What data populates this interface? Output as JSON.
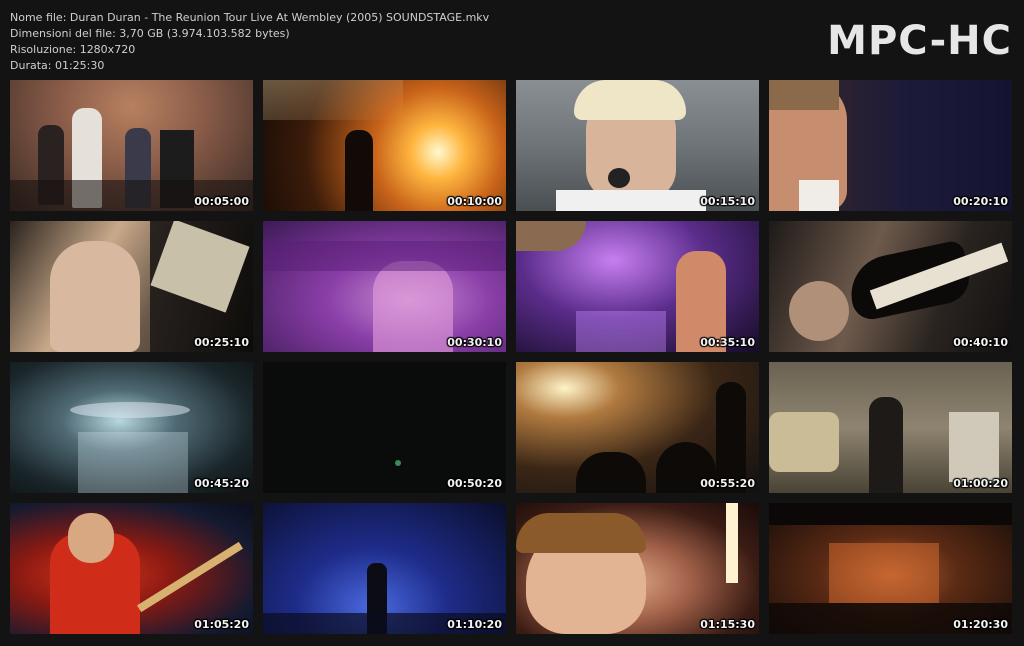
{
  "file_info": {
    "name_line": "Nome file: Duran Duran - The Reunion Tour Live At Wembley (2005) SOUNDSTAGE.mkv",
    "size_line": "Dimensioni del file: 3,70 GB (3.974.103.582 bytes)",
    "resolution_line": "Risoluzione: 1280x720",
    "duration_line": "Durata: 01:25:30"
  },
  "logo": "MPC-HC",
  "thumbnails": [
    {
      "timestamp": "00:05:00"
    },
    {
      "timestamp": "00:10:00"
    },
    {
      "timestamp": "00:15:10"
    },
    {
      "timestamp": "00:20:10"
    },
    {
      "timestamp": "00:25:10"
    },
    {
      "timestamp": "00:30:10"
    },
    {
      "timestamp": "00:35:10"
    },
    {
      "timestamp": "00:40:10"
    },
    {
      "timestamp": "00:45:20"
    },
    {
      "timestamp": "00:50:20"
    },
    {
      "timestamp": "00:55:20"
    },
    {
      "timestamp": "01:00:20"
    },
    {
      "timestamp": "01:05:20"
    },
    {
      "timestamp": "01:10:20"
    },
    {
      "timestamp": "01:15:30"
    },
    {
      "timestamp": "01:20:30"
    }
  ],
  "colors": {
    "background": "#131313",
    "info_text": "#cfcfcf",
    "logo_text": "#e6e6e6",
    "timestamp_text": "#f2f2f2"
  }
}
